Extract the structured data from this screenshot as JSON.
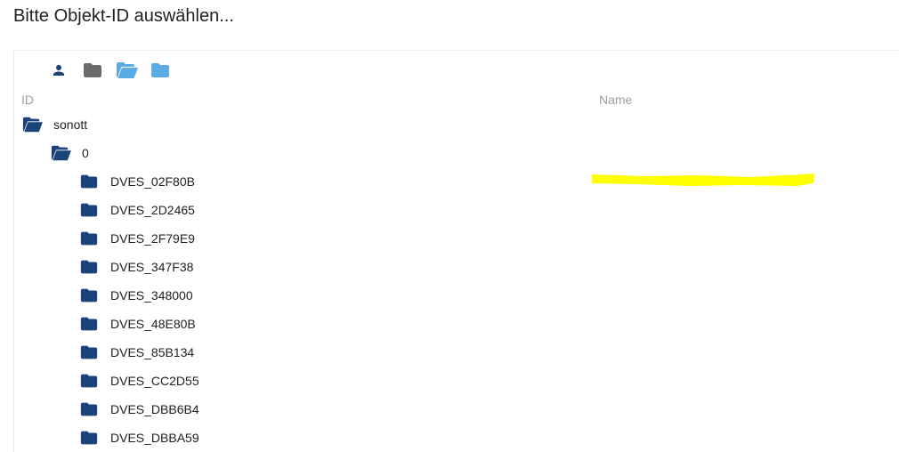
{
  "dialog": {
    "title": "Bitte Objekt-ID auswählen..."
  },
  "toolbar": {
    "icons": [
      "person-icon",
      "folder-gray-icon",
      "folder-open-icon",
      "folder-closed-icon"
    ]
  },
  "columns": {
    "id": "ID",
    "name": "Name"
  },
  "tree": {
    "root": {
      "label": "sonott",
      "state": "expanded"
    },
    "instance": {
      "label": "0",
      "state": "expanded"
    },
    "devices": [
      "DVES_02F80B",
      "DVES_2D2465",
      "DVES_2F79E9",
      "DVES_347F38",
      "DVES_348000",
      "DVES_48E80B",
      "DVES_85B134",
      "DVES_CC2D55",
      "DVES_DBB6B4",
      "DVES_DBBA59"
    ]
  },
  "colors": {
    "folder_dark": "#1a4479",
    "folder_light": "#5aabe6",
    "folder_gray": "#6b6b6b",
    "highlight": "#ffff00"
  }
}
